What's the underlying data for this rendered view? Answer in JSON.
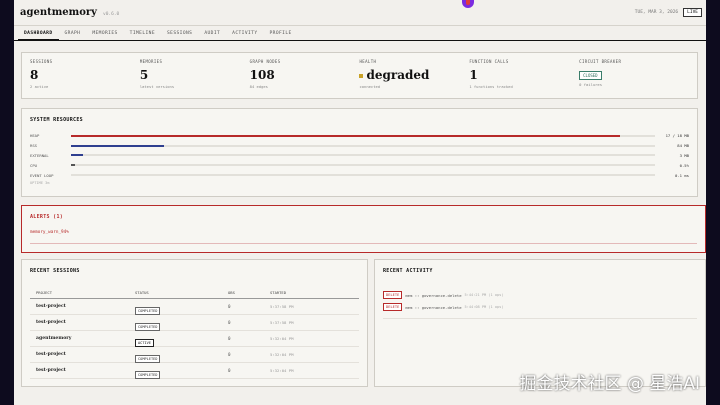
{
  "app": {
    "name": "agentmemory",
    "version": "v0.6.0",
    "date": "TUE, MAR 3, 2026",
    "live_label": "LIVE"
  },
  "nav": [
    "DASHBOARD",
    "GRAPH",
    "MEMORIES",
    "TIMELINE",
    "SESSIONS",
    "AUDIT",
    "ACTIVITY",
    "PROFILE"
  ],
  "stats": {
    "sessions": {
      "label": "SESSIONS",
      "value": "8",
      "sub": "2 active"
    },
    "memories": {
      "label": "MEMORIES",
      "value": "5",
      "sub": "latest versions"
    },
    "graph": {
      "label": "GRAPH NODES",
      "value": "108",
      "sub": "84 edges"
    },
    "health": {
      "label": "HEALTH",
      "value": "degraded",
      "sub": "connected",
      "dot_color": "#c9a227"
    },
    "functions": {
      "label": "FUNCTION CALLS",
      "value": "1",
      "sub": "1 functions tracked"
    },
    "breaker": {
      "label": "CIRCUIT BREAKER",
      "value": "CLOSED",
      "sub": "0 failures"
    }
  },
  "resources": {
    "title": "SYSTEM RESOURCES",
    "rows": [
      {
        "label": "HEAP",
        "value": "17 / 18 MB",
        "fraction": 0.94,
        "color": "#b72a2a"
      },
      {
        "label": "RSS",
        "value": "84 MB",
        "fraction": 0.16,
        "color": "#2f3f8f"
      },
      {
        "label": "EXTERNAL",
        "value": "3 MB",
        "fraction": 0.02,
        "color": "#2f3f8f"
      },
      {
        "label": "CPU",
        "value": "0.5%",
        "fraction": 0.005,
        "color": "#555555"
      },
      {
        "label": "EVENT LOOP",
        "value": "0.1 ms",
        "fraction": 0.0,
        "color": "#555555"
      }
    ],
    "uptime": "UPTIME 3m"
  },
  "alerts": {
    "title": "ALERTS (1)",
    "items": [
      "memory_warn_94%"
    ]
  },
  "sessions": {
    "title": "RECENT SESSIONS",
    "columns": [
      "PROJECT",
      "STATUS",
      "OBS",
      "STARTED"
    ],
    "rows": [
      {
        "project": "test-project",
        "status": "COMPLETED",
        "obs": "0",
        "started": "5:37:58 PM"
      },
      {
        "project": "test-project",
        "status": "COMPLETED",
        "obs": "0",
        "started": "5:37:58 PM"
      },
      {
        "project": "agentmemory",
        "status": "ACTIVE",
        "obs": "0",
        "started": "5:32:04 PM"
      },
      {
        "project": "test-project",
        "status": "COMPLETED",
        "obs": "0",
        "started": "5:32:04 PM"
      },
      {
        "project": "test-project",
        "status": "COMPLETED",
        "obs": "0",
        "started": "5:32:04 PM"
      }
    ]
  },
  "activity": {
    "title": "RECENT ACTIVITY",
    "items": [
      {
        "badge": "DELETE",
        "text": "mem :: governance-delete",
        "time": "5:44:21 PM (1 ops)"
      },
      {
        "badge": "DELETE",
        "text": "mem :: governance-delete",
        "time": "5:44:08 PM (1 ops)"
      }
    ]
  },
  "watermark": "掘金技术社区 @ 星浩AI"
}
